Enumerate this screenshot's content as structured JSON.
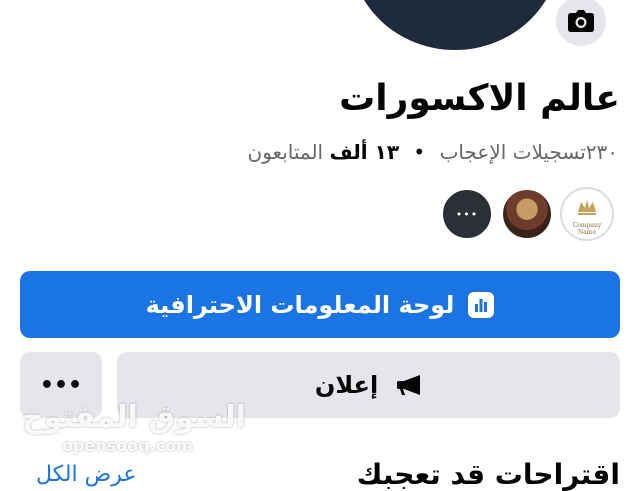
{
  "profile": {
    "name": "عالم الاكسورات",
    "likes": "٢٣٠",
    "likes_label": "تسجيلات الإعجاب",
    "followers": "١٣ ألف",
    "followers_label": "المتابعون",
    "separator": "•"
  },
  "logo_caption": "Company Name",
  "more_glyph": "•••",
  "buttons": {
    "dashboard": "لوحة المعلومات الاحترافية",
    "promote": "إعلان",
    "more": "•••"
  },
  "suggestions": {
    "title": "اقتراحات قد تعجبك",
    "see_all": "عرض الكل"
  },
  "watermark": {
    "arabic": "السوق المفتوح",
    "latin": "opensooq.com"
  },
  "icons": {
    "camera": "camera-icon",
    "dashboard": "bar-chart-icon",
    "promote": "megaphone-icon"
  },
  "colors": {
    "accent": "#1b74e4",
    "button_gray": "#e4e6eb",
    "secondary_text": "#65676b"
  }
}
